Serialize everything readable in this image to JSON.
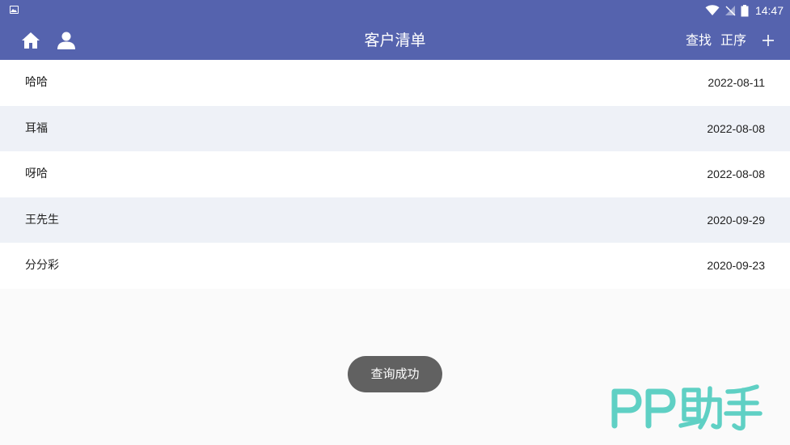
{
  "status_bar": {
    "time": "14:47"
  },
  "app_bar": {
    "title": "客户清单",
    "search_label": "查找",
    "sort_label": "正序"
  },
  "customers": [
    {
      "name": "哈哈",
      "date": "2022-08-11"
    },
    {
      "name": "耳福",
      "date": "2022-08-08"
    },
    {
      "name": "呀哈",
      "date": "2022-08-08"
    },
    {
      "name": "王先生",
      "date": "2020-09-29"
    },
    {
      "name": "分分彩",
      "date": "2020-09-23"
    }
  ],
  "toast": {
    "message": "查询成功"
  },
  "watermark": {
    "text": "PP助手",
    "color": "#5fd0c4"
  },
  "colors": {
    "primary": "#5563ae",
    "row_alt": "#eef1f7",
    "toast_bg": "#616161"
  }
}
